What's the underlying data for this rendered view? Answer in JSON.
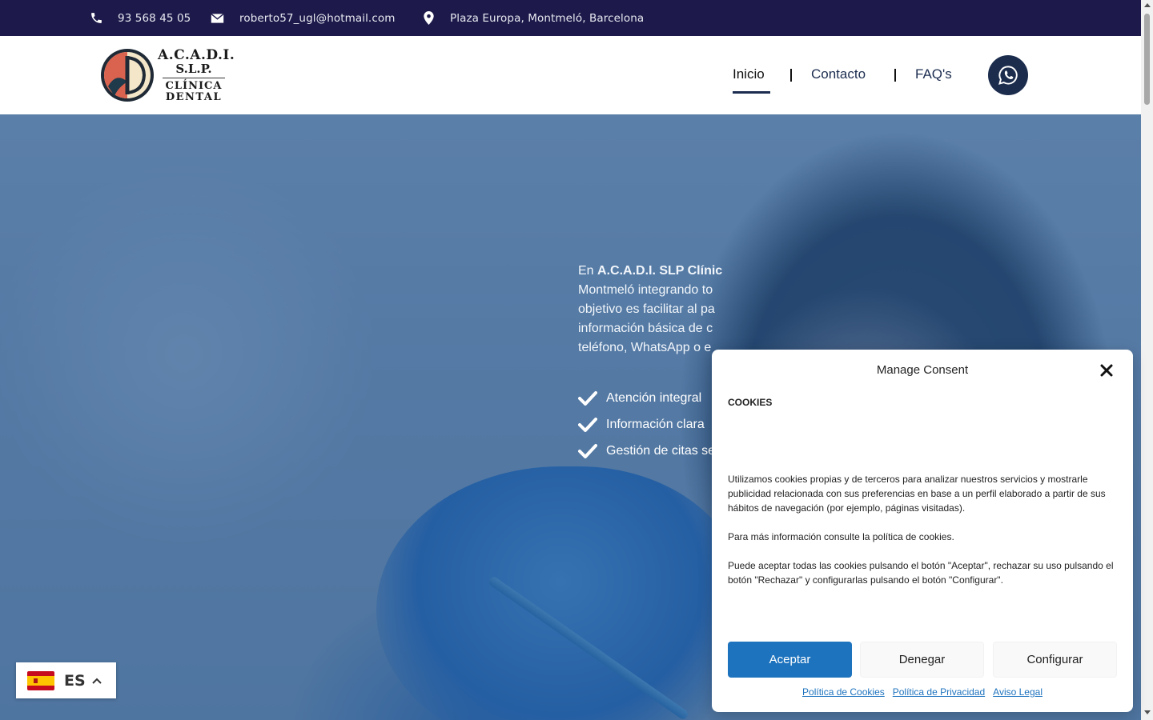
{
  "topbar": {
    "phone": "93 568 45 05",
    "email": "roberto57_ugl@hotmail.com",
    "address": "Plaza Europa, Montmeló, Barcelona",
    "background": "#1d1a4b"
  },
  "logo": {
    "line1": "A.C.A.D.I.",
    "line2": "S.L.P.",
    "line3": "CLÍNICA",
    "line4": "DENTAL"
  },
  "nav": {
    "items": [
      {
        "label": "Inicio",
        "active": true
      },
      {
        "label": "Contacto",
        "active": false
      },
      {
        "label": "FAQ's",
        "active": false
      }
    ],
    "whatsapp_icon": "whatsapp-icon",
    "accent": "#1b2c4d"
  },
  "hero": {
    "para_prefix": "En ",
    "para_bold": "A.C.A.D.I. SLP Clínic",
    "para_line2": "Montmeló integrando to",
    "para_line3": "objetivo es facilitar al pa",
    "para_line4": "información básica de c",
    "para_line5": "teléfono, WhatsApp o e",
    "features": [
      "Atención integral",
      "Información clara",
      "Gestión de citas se"
    ],
    "overlay_color": "#215691"
  },
  "language": {
    "code": "ES",
    "flag": "spain-flag-icon"
  },
  "consent": {
    "title": "Manage Consent",
    "heading": "COOKIES",
    "paragraphs": [
      "Utilizamos cookies propias y de terceros para analizar nuestros servicios y mostrarle publicidad relacionada con sus preferencias en base a un perfil elaborado a partir de sus hábitos de navegación (por ejemplo, páginas visitadas).",
      "Para más información consulte la política de cookies.",
      "Puede aceptar todas las cookies pulsando el botón \"Aceptar\", rechazar su uso pulsando el botón \"Rechazar\" y configurarlas pulsando el botón \"Configurar\"."
    ],
    "buttons": {
      "accept": "Aceptar",
      "deny": "Denegar",
      "configure": "Configurar"
    },
    "links": [
      "Política de Cookies",
      "Política de Privacidad",
      "Aviso Legal"
    ],
    "accent": "#1e73be"
  }
}
